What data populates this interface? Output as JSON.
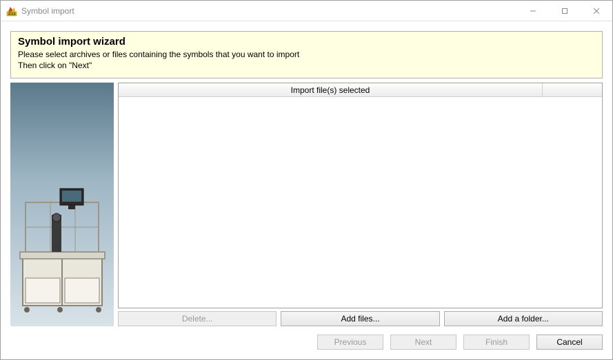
{
  "window": {
    "title": "Symbol import"
  },
  "wizard": {
    "title": "Symbol import wizard",
    "instruction_line1": "Please select archives or files containing the symbols that you want to import",
    "instruction_line2": "Then click on \"Next\""
  },
  "table": {
    "header_col1": "Import file(s) selected",
    "rows": []
  },
  "buttons": {
    "delete": "Delete...",
    "add_files": "Add files...",
    "add_folder": "Add a folder..."
  },
  "nav": {
    "previous": "Previous",
    "next": "Next",
    "finish": "Finish",
    "cancel": "Cancel"
  }
}
